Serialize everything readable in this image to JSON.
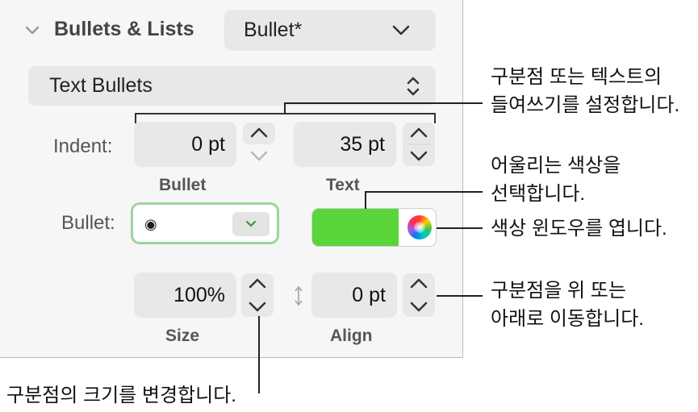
{
  "section": {
    "title": "Bullets & Lists",
    "style_popup_value": "Bullet*",
    "type_popup_value": "Text Bullets"
  },
  "indent": {
    "label": "Indent:",
    "bullet_value": "0 pt",
    "text_value": "35 pt",
    "bullet_caption": "Bullet",
    "text_caption": "Text"
  },
  "bullet": {
    "label": "Bullet:",
    "glyph": "◉",
    "color": "#59d53a"
  },
  "size": {
    "value": "100%",
    "caption": "Size"
  },
  "align": {
    "value": "0 pt",
    "caption": "Align"
  },
  "callouts": {
    "indent_line1": "구분점 또는 텍스트의",
    "indent_line2": "들여쓰기를 설정합니다.",
    "color_line1": "어울리는 색상을",
    "color_line2": "선택합니다.",
    "wheel": "색상 윈도우를 엽니다.",
    "align_line1": "구분점을 위 또는",
    "align_line2": "아래로 이동합니다.",
    "size": "구분점의 크기를 변경합니다."
  }
}
